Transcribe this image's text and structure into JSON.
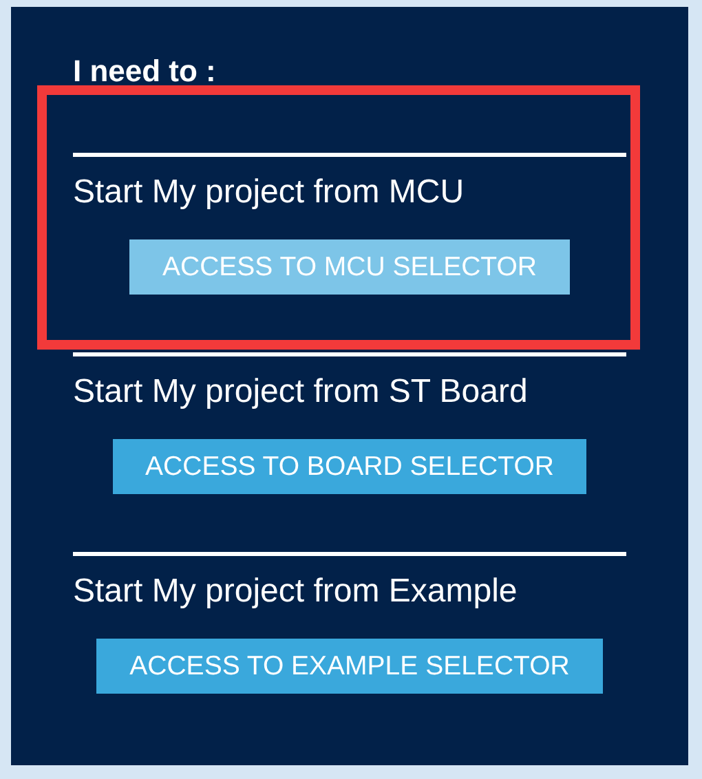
{
  "heading": "I need to :",
  "sections": [
    {
      "label": "Start My project from MCU",
      "button": "ACCESS TO MCU SELECTOR",
      "highlighted": true,
      "framed": true
    },
    {
      "label": "Start My project from ST Board",
      "button": "ACCESS TO BOARD SELECTOR",
      "highlighted": false,
      "framed": false
    },
    {
      "label": "Start My project from Example",
      "button": "ACCESS TO EXAMPLE SELECTOR",
      "highlighted": false,
      "framed": false
    }
  ]
}
